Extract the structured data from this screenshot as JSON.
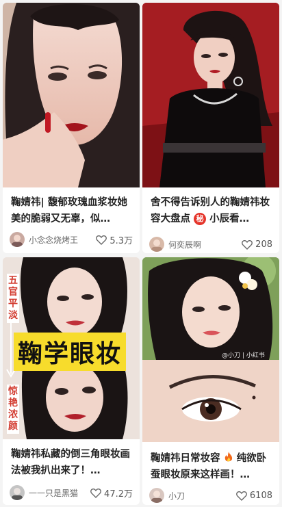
{
  "cards": [
    {
      "title": "鞠婧祎| 馥郁玫瑰血浆妆她美的脆弱又无辜，似…",
      "author": "小念念烧烤王",
      "likes": "5.3万",
      "image_icon": "portrait-photo"
    },
    {
      "title_before": "舍不得告诉别人的鞠婧祎妆容大盘点",
      "badge": "秘",
      "title_after": "小辰看…",
      "author": "何奕辰啊",
      "likes": "208",
      "image_icon": "portrait-photo"
    },
    {
      "title": "鞠婧祎私藏的倒三角眼妆画法被我扒出来了！…",
      "author": "一一只是黑猫",
      "likes": "47.2万",
      "overlay_main": "鞠学眼妆",
      "overlay_top": "五官平淡",
      "overlay_bottom": "惊艳浓颜",
      "image_icon": "portrait-photo"
    },
    {
      "title_before": "鞠婧祎日常妆容",
      "title_after": "纯欲卧蚕眼妆原来这样画！…",
      "author": "小刀",
      "likes": "6108",
      "watermark": "@小刀 | 小红书",
      "image_icon": "portrait-photo"
    }
  ],
  "icons": {
    "like": "heart-outline-icon",
    "emoji": "fire-icon"
  }
}
